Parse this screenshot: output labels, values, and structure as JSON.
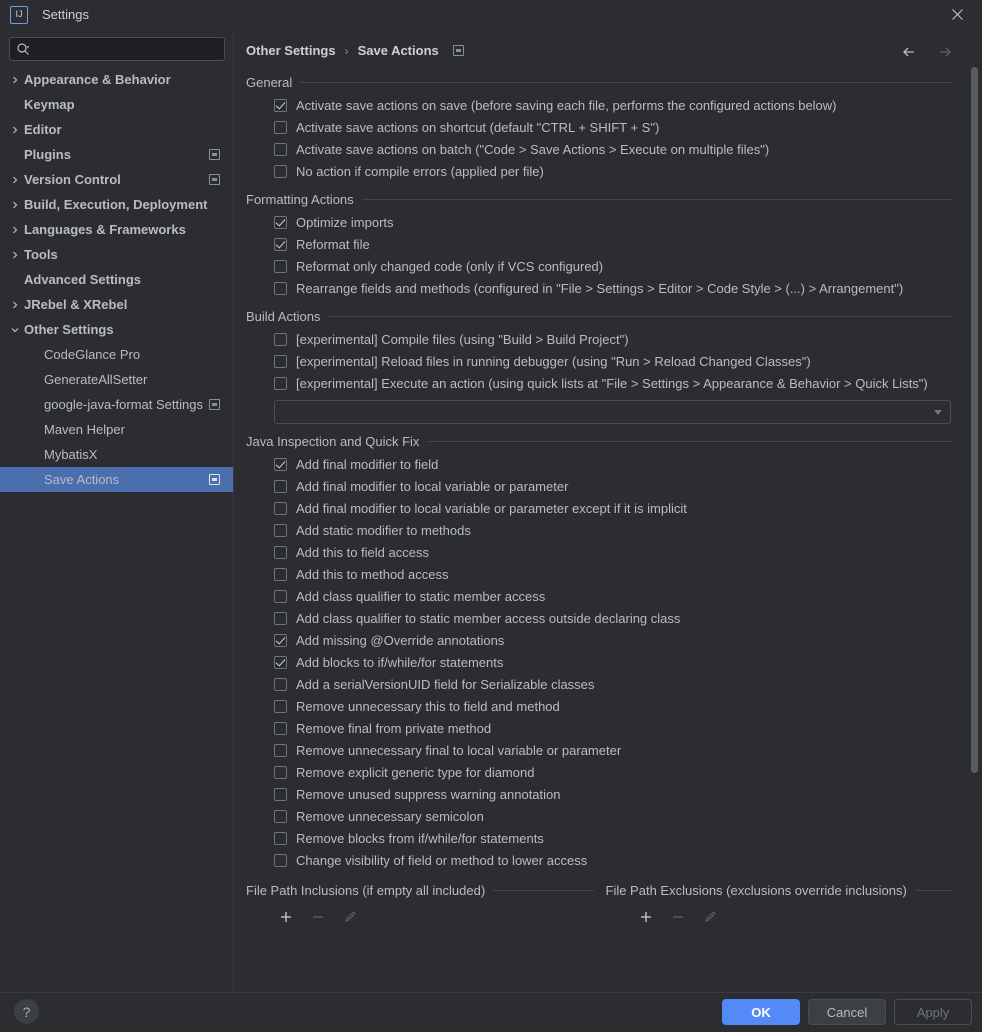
{
  "window": {
    "title": "Settings",
    "logo_icon": "intellij-idea-logo",
    "close_icon": "close-icon"
  },
  "search": {
    "placeholder": "",
    "value": "",
    "icon": "search-icon"
  },
  "sidebar": {
    "items": [
      {
        "label": "Appearance & Behavior",
        "arrow": "chevron-right-icon",
        "bold": true,
        "child": false,
        "badge": false,
        "selected": false
      },
      {
        "label": "Keymap",
        "arrow": "",
        "bold": true,
        "child": false,
        "badge": false,
        "selected": false
      },
      {
        "label": "Editor",
        "arrow": "chevron-right-icon",
        "bold": true,
        "child": false,
        "badge": false,
        "selected": false
      },
      {
        "label": "Plugins",
        "arrow": "",
        "bold": true,
        "child": false,
        "badge": true,
        "selected": false
      },
      {
        "label": "Version Control",
        "arrow": "chevron-right-icon",
        "bold": true,
        "child": false,
        "badge": true,
        "selected": false
      },
      {
        "label": "Build, Execution, Deployment",
        "arrow": "chevron-right-icon",
        "bold": true,
        "child": false,
        "badge": false,
        "selected": false
      },
      {
        "label": "Languages & Frameworks",
        "arrow": "chevron-right-icon",
        "bold": true,
        "child": false,
        "badge": false,
        "selected": false
      },
      {
        "label": "Tools",
        "arrow": "chevron-right-icon",
        "bold": true,
        "child": false,
        "badge": false,
        "selected": false
      },
      {
        "label": "Advanced Settings",
        "arrow": "",
        "bold": true,
        "child": false,
        "badge": false,
        "selected": false
      },
      {
        "label": "JRebel & XRebel",
        "arrow": "chevron-right-icon",
        "bold": true,
        "child": false,
        "badge": false,
        "selected": false
      },
      {
        "label": "Other Settings",
        "arrow": "chevron-down-icon",
        "bold": true,
        "child": false,
        "badge": false,
        "selected": false
      },
      {
        "label": "CodeGlance Pro",
        "arrow": "",
        "bold": false,
        "child": true,
        "badge": false,
        "selected": false
      },
      {
        "label": "GenerateAllSetter",
        "arrow": "",
        "bold": false,
        "child": true,
        "badge": false,
        "selected": false
      },
      {
        "label": "google-java-format Settings",
        "arrow": "",
        "bold": false,
        "child": true,
        "badge": true,
        "selected": false
      },
      {
        "label": "Maven Helper",
        "arrow": "",
        "bold": false,
        "child": true,
        "badge": false,
        "selected": false
      },
      {
        "label": "MybatisX",
        "arrow": "",
        "bold": false,
        "child": true,
        "badge": false,
        "selected": false
      },
      {
        "label": "Save Actions",
        "arrow": "",
        "bold": false,
        "child": true,
        "badge": true,
        "selected": true
      }
    ]
  },
  "breadcrumb": {
    "parent": "Other Settings",
    "separator": "›",
    "current": "Save Actions",
    "scope_icon": "project-scope-icon"
  },
  "navigation": {
    "back_icon": "arrow-left-icon",
    "forward_icon": "arrow-right-icon"
  },
  "sections": [
    {
      "title": "General",
      "options": [
        {
          "label": "Activate save actions on save (before saving each file, performs the configured actions below)",
          "checked": true
        },
        {
          "label": "Activate save actions on shortcut (default \"CTRL + SHIFT + S\")",
          "checked": false
        },
        {
          "label": "Activate save actions on batch (\"Code > Save Actions > Execute on multiple files\")",
          "checked": false
        },
        {
          "label": "No action if compile errors (applied per file)",
          "checked": false
        }
      ]
    },
    {
      "title": "Formatting Actions",
      "options": [
        {
          "label": "Optimize imports",
          "checked": true
        },
        {
          "label": "Reformat file",
          "checked": true
        },
        {
          "label": "Reformat only changed code (only if VCS configured)",
          "checked": false
        },
        {
          "label": "Rearrange fields and methods (configured in \"File > Settings > Editor > Code Style > (...) > Arrangement\")",
          "checked": false
        }
      ]
    },
    {
      "title": "Build Actions",
      "options": [
        {
          "label": "[experimental] Compile files (using \"Build > Build Project\")",
          "checked": false
        },
        {
          "label": "[experimental] Reload files in running debugger (using \"Run > Reload Changed Classes\")",
          "checked": false
        },
        {
          "label": "[experimental] Execute an action (using quick lists at \"File > Settings > Appearance & Behavior > Quick Lists\")",
          "checked": false
        }
      ],
      "combo": {
        "value": "",
        "chevron_icon": "chevron-down-icon"
      }
    },
    {
      "title": "Java Inspection and Quick Fix",
      "options": [
        {
          "label": "Add final modifier to field",
          "checked": true
        },
        {
          "label": "Add final modifier to local variable or parameter",
          "checked": false
        },
        {
          "label": "Add final modifier to local variable or parameter except if it is implicit",
          "checked": false
        },
        {
          "label": "Add static modifier to methods",
          "checked": false
        },
        {
          "label": "Add this to field access",
          "checked": false
        },
        {
          "label": "Add this to method access",
          "checked": false
        },
        {
          "label": "Add class qualifier to static member access",
          "checked": false
        },
        {
          "label": "Add class qualifier to static member access outside declaring class",
          "checked": false
        },
        {
          "label": "Add missing @Override annotations",
          "checked": true
        },
        {
          "label": "Add blocks to if/while/for statements",
          "checked": true
        },
        {
          "label": "Add a serialVersionUID field for Serializable classes",
          "checked": false
        },
        {
          "label": "Remove unnecessary this to field and method",
          "checked": false
        },
        {
          "label": "Remove final from private method",
          "checked": false
        },
        {
          "label": "Remove unnecessary final to local variable or parameter",
          "checked": false
        },
        {
          "label": "Remove explicit generic type for diamond",
          "checked": false
        },
        {
          "label": "Remove unused suppress warning annotation",
          "checked": false
        },
        {
          "label": "Remove unnecessary semicolon",
          "checked": false
        },
        {
          "label": "Remove blocks from if/while/for statements",
          "checked": false
        },
        {
          "label": "Change visibility of field or method to lower access",
          "checked": false
        }
      ]
    }
  ],
  "path_panes": {
    "inclusions": {
      "title": "File Path Inclusions (if empty all included)",
      "add_icon": "plus-icon",
      "remove_icon": "minus-icon",
      "edit_icon": "pencil-icon"
    },
    "exclusions": {
      "title": "File Path Exclusions (exclusions override inclusions)",
      "add_icon": "plus-icon",
      "remove_icon": "minus-icon",
      "edit_icon": "pencil-icon"
    }
  },
  "footer": {
    "help_label": "?",
    "ok_label": "OK",
    "cancel_label": "Cancel",
    "apply_label": "Apply"
  },
  "colors": {
    "background": "#2b2d30",
    "selection": "#4b6eaf",
    "primary_button": "#548af7",
    "text": "#b9bcc2",
    "border": "#43454a"
  }
}
